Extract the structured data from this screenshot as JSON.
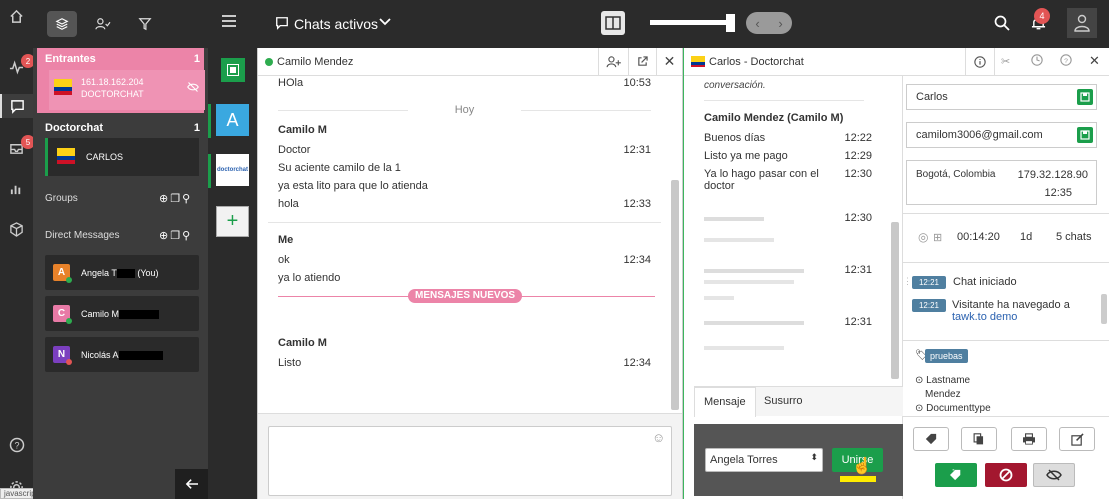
{
  "rail": {
    "badge_activity": "2",
    "badge_inbox": "5",
    "status_url": "javascript:void(0);"
  },
  "sidebar": {
    "entrantes": {
      "title": "Entrantes",
      "count": "1",
      "ip": "161.18.162.204",
      "source": "DOCTORCHAT"
    },
    "doctorchat": {
      "title": "Doctorchat",
      "count": "1",
      "visitor": "CARLOS"
    },
    "groups_label": "Groups",
    "dm_label": "Direct Messages",
    "dms": [
      {
        "initial": "A",
        "name": "Angela T",
        "suffix": "(You)",
        "color": "#e8822a",
        "status": "#2eac4f"
      },
      {
        "initial": "C",
        "name": "Camilo M",
        "suffix": "",
        "color": "#e87aa6",
        "status": "#2eac4f"
      },
      {
        "initial": "N",
        "name": "Nicolás A",
        "suffix": "",
        "color": "#7b3fbf",
        "status": "#e25555"
      }
    ]
  },
  "lrail": {
    "letter": "A",
    "logo_text": "doctorchat"
  },
  "topbar": {
    "title": "Chats activos",
    "notif_count": "4"
  },
  "left_chat": {
    "name": "Camilo Mendez",
    "messages": [
      {
        "text": "HOla",
        "time": "10:53"
      }
    ],
    "divider_today": "Hoy",
    "group1": {
      "sender": "Camilo M",
      "lines": [
        {
          "text": "Doctor",
          "time": "12:31"
        },
        {
          "text": "Su aciente camilo de la 1",
          "time": ""
        },
        {
          "text": "ya esta lito para que lo atienda",
          "time": ""
        },
        {
          "text": "hola",
          "time": "12:33"
        }
      ]
    },
    "group2": {
      "sender": "Me",
      "lines": [
        {
          "text": "ok",
          "time": "12:34"
        },
        {
          "text": "ya lo atiendo",
          "time": ""
        }
      ]
    },
    "new_messages": "MENSAJES NUEVOS",
    "group3": {
      "sender": "Camilo M",
      "lines": [
        {
          "text": "Listo",
          "time": "12:34"
        }
      ]
    }
  },
  "right_chat": {
    "title": "Carlos - Doctorchat",
    "intro": "conversación.",
    "sender": "Camilo Mendez (Camilo M",
    "sender_end": ")",
    "lines": [
      {
        "text": "Buenos días",
        "time": "12:22"
      },
      {
        "text": "Listo ya me pago",
        "time": "12:29"
      },
      {
        "text": "Ya lo hago pasar con el",
        "text2": "doctor",
        "time": "12:30"
      }
    ],
    "blur_times": [
      "12:30",
      "12:31",
      "12:31"
    ],
    "tab_message": "Mensaje",
    "tab_whisper": "Susurro",
    "agent_select": "Angela Torres",
    "join_button": "Unirse"
  },
  "visitor": {
    "name": "Carlos",
    "email": "camilom3006@gmail.com",
    "location": "Bogotá, Colombia",
    "ip": "179.32.128.90",
    "local_time": "12:35",
    "duration": "00:14:20",
    "days": "1d",
    "chats": "5 chats",
    "events": [
      {
        "time": "12:21",
        "text": "Chat iniciado"
      },
      {
        "time": "12:21",
        "text": "Visitante ha navegado a",
        "link": "tawk.to demo"
      }
    ],
    "tag": "pruebas",
    "attrs": [
      "Lastname",
      "Mendez",
      "Documenttype"
    ]
  },
  "colors": {
    "green": "#1b9e4b",
    "pink": "#ec84a8",
    "dark": "#2b2b2b",
    "tealtag": "#4f7fa0"
  }
}
